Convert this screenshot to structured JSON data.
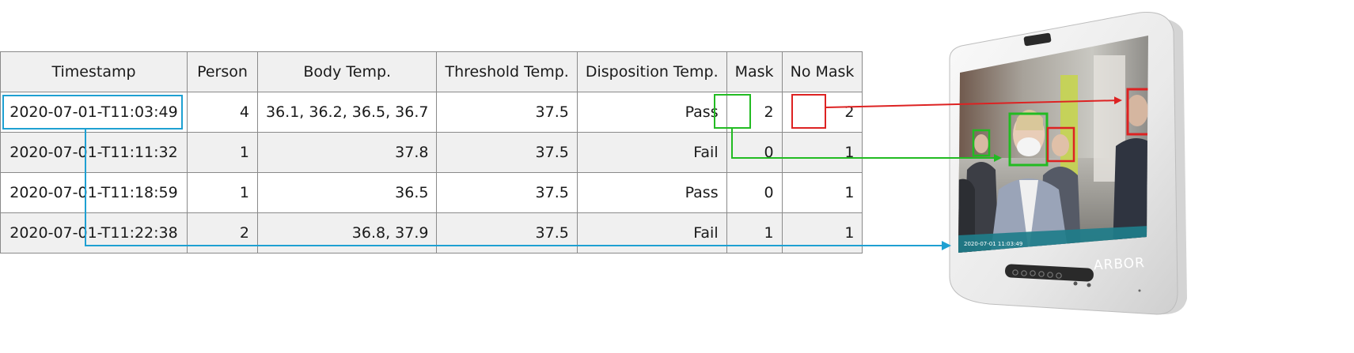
{
  "table": {
    "headers": [
      "Timestamp",
      "Person",
      "Body Temp.",
      "Threshold Temp.",
      "Disposition Temp.",
      "Mask",
      "No Mask"
    ],
    "rows": [
      [
        "2020-07-01-T11:03:49",
        "4",
        "36.1, 36.2, 36.5, 36.7",
        "37.5",
        "Pass",
        "2",
        "2"
      ],
      [
        "2020-07-01-T11:11:32",
        "1",
        "37.8",
        "37.5",
        "Fail",
        "0",
        "1"
      ],
      [
        "2020-07-01-T11:18:59",
        "1",
        "36.5",
        "37.5",
        "Pass",
        "0",
        "1"
      ],
      [
        "2020-07-01-T11:22:38",
        "2",
        "36.8, 37.9",
        "37.5",
        "Fail",
        "1",
        "1"
      ]
    ]
  },
  "device": {
    "brand": "ARBOR",
    "screen_timestamp": "2020-07-01  11:03:49"
  },
  "colors": {
    "timestamp_highlight": "#1ea0d2",
    "mask_highlight": "#22bb22",
    "no_mask_highlight": "#dd2222"
  }
}
